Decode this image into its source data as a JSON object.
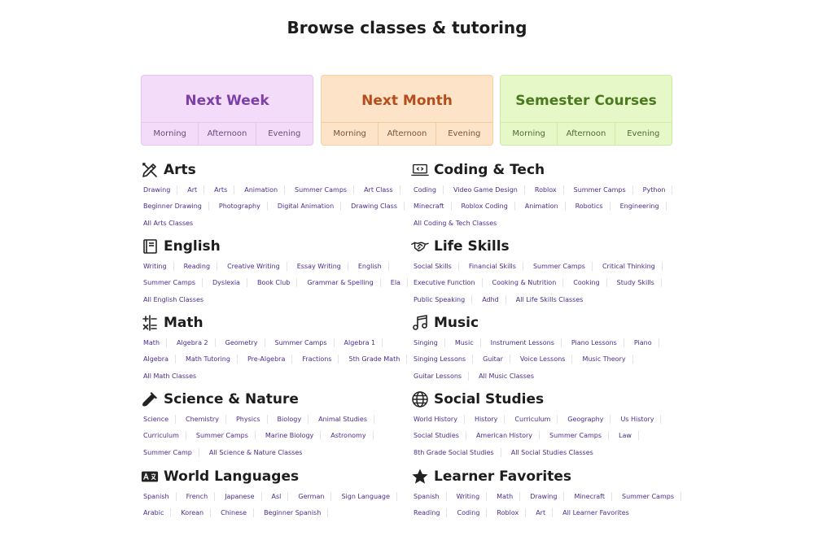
{
  "page_title": "Browse classes & tutoring",
  "cards": [
    {
      "title": "Next Week",
      "slots": [
        "Morning",
        "Afternoon",
        "Evening"
      ]
    },
    {
      "title": "Next Month",
      "slots": [
        "Morning",
        "Afternoon",
        "Evening"
      ]
    },
    {
      "title": "Semester Courses",
      "slots": [
        "Morning",
        "Afternoon",
        "Evening"
      ]
    }
  ],
  "sections": {
    "arts": {
      "title": "Arts",
      "icon": "pencil-ruler-icon",
      "rows": [
        [
          "Drawing",
          "Art",
          "Arts",
          "Animation",
          "Summer Camps",
          "Art Class"
        ],
        [
          "Beginner Drawing",
          "Photography",
          "Digital Animation",
          "Drawing Class"
        ],
        [
          "All Arts Classes"
        ]
      ]
    },
    "coding": {
      "title": "Coding & Tech",
      "icon": "laptop-code-icon",
      "rows": [
        [
          "Coding",
          "Video Game Design",
          "Roblox",
          "Summer Camps",
          "Python"
        ],
        [
          "Minecraft",
          "Roblox Coding",
          "Animation",
          "Robotics",
          "Engineering"
        ],
        [
          "All Coding & Tech Classes"
        ]
      ]
    },
    "english": {
      "title": "English",
      "icon": "book-icon",
      "rows": [
        [
          "Writing",
          "Reading",
          "Creative Writing",
          "Essay Writing",
          "English"
        ],
        [
          "Summer Camps",
          "Dyslexia",
          "Book Club",
          "Grammar & Spelling",
          "Ela"
        ],
        [
          "All English Classes"
        ]
      ]
    },
    "life": {
      "title": "Life Skills",
      "icon": "handshake-icon",
      "rows": [
        [
          "Social Skills",
          "Financial Skills",
          "Summer Camps",
          "Critical Thinking"
        ],
        [
          "Executive Function",
          "Cooking & Nutrition",
          "Cooking",
          "Study Skills"
        ],
        [
          "Public Speaking",
          "Adhd",
          "All Life Skills Classes"
        ]
      ]
    },
    "math": {
      "title": "Math",
      "icon": "math-symbols-icon",
      "rows": [
        [
          "Math",
          "Algebra 2",
          "Geometry",
          "Summer Camps",
          "Algebra 1"
        ],
        [
          "Algebra",
          "Math Tutoring",
          "Pre-Algebra",
          "Fractions",
          "5th Grade Math"
        ],
        [
          "All Math Classes"
        ]
      ]
    },
    "music": {
      "title": "Music",
      "icon": "music-note-icon",
      "rows": [
        [
          "Singing",
          "Music",
          "Instrument Lessons",
          "Piano Lessons",
          "Piano"
        ],
        [
          "Singing Lessons",
          "Guitar",
          "Voice Lessons",
          "Music Theory"
        ],
        [
          "Guitar Lessons",
          "All Music Classes"
        ]
      ]
    },
    "science": {
      "title": "Science & Nature",
      "icon": "test-tube-icon",
      "rows": [
        [
          "Science",
          "Chemistry",
          "Physics",
          "Biology",
          "Animal Studies"
        ],
        [
          "Curriculum",
          "Summer Camps",
          "Marine Biology",
          "Astronomy"
        ],
        [
          "Summer Camp",
          "All Science & Nature Classes"
        ]
      ]
    },
    "social": {
      "title": "Social Studies",
      "icon": "globe-icon",
      "rows": [
        [
          "World History",
          "History",
          "Curriculum",
          "Geography",
          "Us History"
        ],
        [
          "Social Studies",
          "American History",
          "Summer Camps",
          "Law"
        ],
        [
          "8th Grade Social Studies",
          "All Social Studies Classes"
        ]
      ]
    },
    "languages": {
      "title": "World Languages",
      "icon": "language-icon",
      "rows": [
        [
          "Spanish",
          "French",
          "Japanese",
          "Asl",
          "German",
          "Sign Language"
        ],
        [
          "Arabic",
          "Korean",
          "Chinese",
          "Beginner Spanish"
        ]
      ]
    },
    "favorites": {
      "title": "Learner Favorites",
      "icon": "star-icon",
      "rows": [
        [
          "Spanish",
          "Writing",
          "Math",
          "Drawing",
          "Minecraft",
          "Summer Camps"
        ],
        [
          "Reading",
          "Coding",
          "Roblox",
          "Art",
          "All Learner Favorites"
        ]
      ]
    }
  }
}
